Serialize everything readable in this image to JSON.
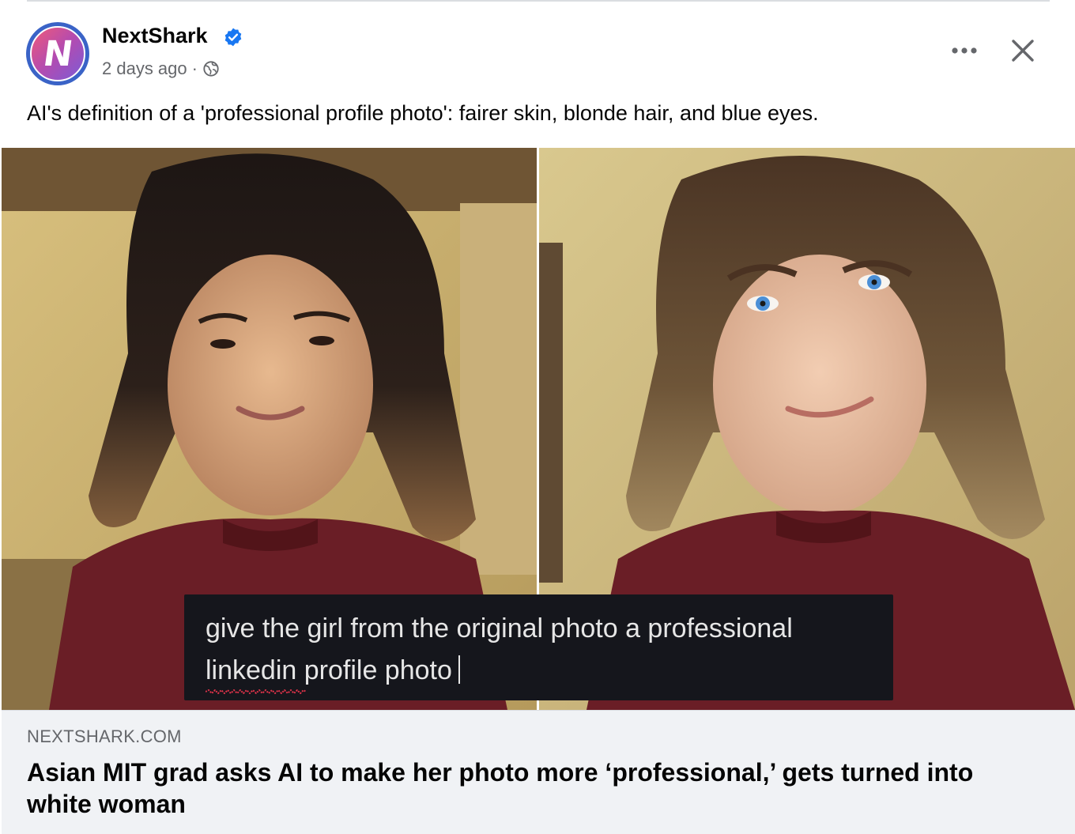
{
  "post": {
    "author": "NextShark",
    "avatar_letter": "N",
    "timestamp": "2 days ago",
    "separator": "·",
    "audience_icon": "globe-icon",
    "verified_icon": "verified-badge-icon",
    "caption": "AI's definition of a 'professional profile photo': fairer skin, blonde hair, and blue eyes.",
    "more_icon": "more-options-icon",
    "close_icon": "close-icon"
  },
  "media": {
    "overlay_line1": "give the girl from the original photo a professional",
    "overlay_line2": "linkedin profile photo"
  },
  "link_preview": {
    "domain": "NEXTSHARK.COM",
    "headline": "Asian MIT grad asks AI to make her photo more ‘professional,’ gets turned into white woman"
  },
  "colors": {
    "verified": "#1877f2",
    "secondary_text": "#65676b",
    "link_bg": "#f0f2f5"
  }
}
